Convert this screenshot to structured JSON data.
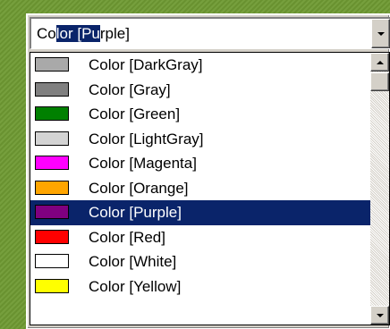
{
  "combo": {
    "text_before": "Co",
    "text_selected": "lor [Pu",
    "text_after": "rple]"
  },
  "list": {
    "selected_index": 6,
    "items": [
      {
        "label": "Color [DarkGray]",
        "swatch": "#a9a9a9"
      },
      {
        "label": "Color [Gray]",
        "swatch": "#808080"
      },
      {
        "label": "Color [Green]",
        "swatch": "#008000"
      },
      {
        "label": "Color [LightGray]",
        "swatch": "#d3d3d3"
      },
      {
        "label": "Color [Magenta]",
        "swatch": "#ff00ff"
      },
      {
        "label": "Color [Orange]",
        "swatch": "#ffa500"
      },
      {
        "label": "Color [Purple]",
        "swatch": "#800080"
      },
      {
        "label": "Color [Red]",
        "swatch": "#ff0000"
      },
      {
        "label": "Color [White]",
        "swatch": "#ffffff"
      },
      {
        "label": "Color [Yellow]",
        "swatch": "#ffff00"
      }
    ]
  },
  "colors": {
    "desktop": "#6f9a33",
    "selection": "#0a246a",
    "face": "#d4d0c8"
  }
}
